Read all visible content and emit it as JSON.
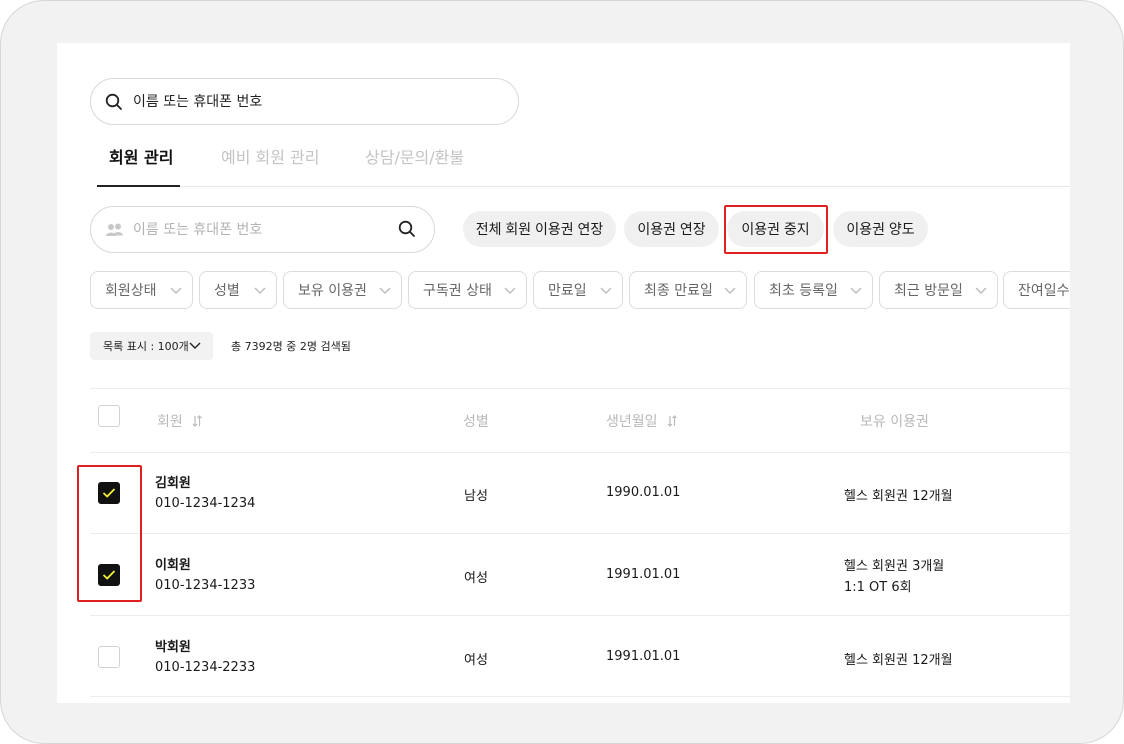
{
  "global_search": {
    "placeholder": "이름 또는 휴대폰 번호"
  },
  "tabs": [
    {
      "label": "회원 관리",
      "active": true
    },
    {
      "label": "예비 회원 관리",
      "active": false
    },
    {
      "label": "상담/문의/환불",
      "active": false
    }
  ],
  "member_search": {
    "placeholder": "이름 또는 휴대폰 번호"
  },
  "actions": {
    "extend_all": "전체 회원 이용권 연장",
    "extend": "이용권 연장",
    "suspend": "이용권 중지",
    "transfer": "이용권 양도"
  },
  "filters": [
    "회원상태",
    "성별",
    "보유 이용권",
    "구독권 상태",
    "만료일",
    "최종 만료일",
    "최초 등록일",
    "최근 방문일",
    "잔여일수"
  ],
  "list": {
    "page_size_label": "목록 표시 : 100개",
    "result_count": "총 7392명 중 2명 검색됨"
  },
  "table": {
    "headers": {
      "member": "회원",
      "gender": "성별",
      "birth": "생년월일",
      "pass": "보유 이용권"
    },
    "rows": [
      {
        "name": "김회원",
        "phone": "010-1234-1234",
        "gender": "남성",
        "birth": "1990.01.01",
        "pass_1": "헬스 회원권 12개월",
        "pass_2": "",
        "checked": true
      },
      {
        "name": "이회원",
        "phone": "010-1234-1233",
        "gender": "여성",
        "birth": "1991.01.01",
        "pass_1": "헬스 회원권 3개월",
        "pass_2": "1:1 OT 6회",
        "checked": true
      },
      {
        "name": "박회원",
        "phone": "010-1234-2233",
        "gender": "여성",
        "birth": "1991.01.01",
        "pass_1": "헬스 회원권 12개월",
        "pass_2": "",
        "checked": false
      }
    ]
  },
  "colors": {
    "highlight": "#e02020",
    "checkbox_checked_bg": "#111111",
    "checkmark": "#f2f23a"
  }
}
